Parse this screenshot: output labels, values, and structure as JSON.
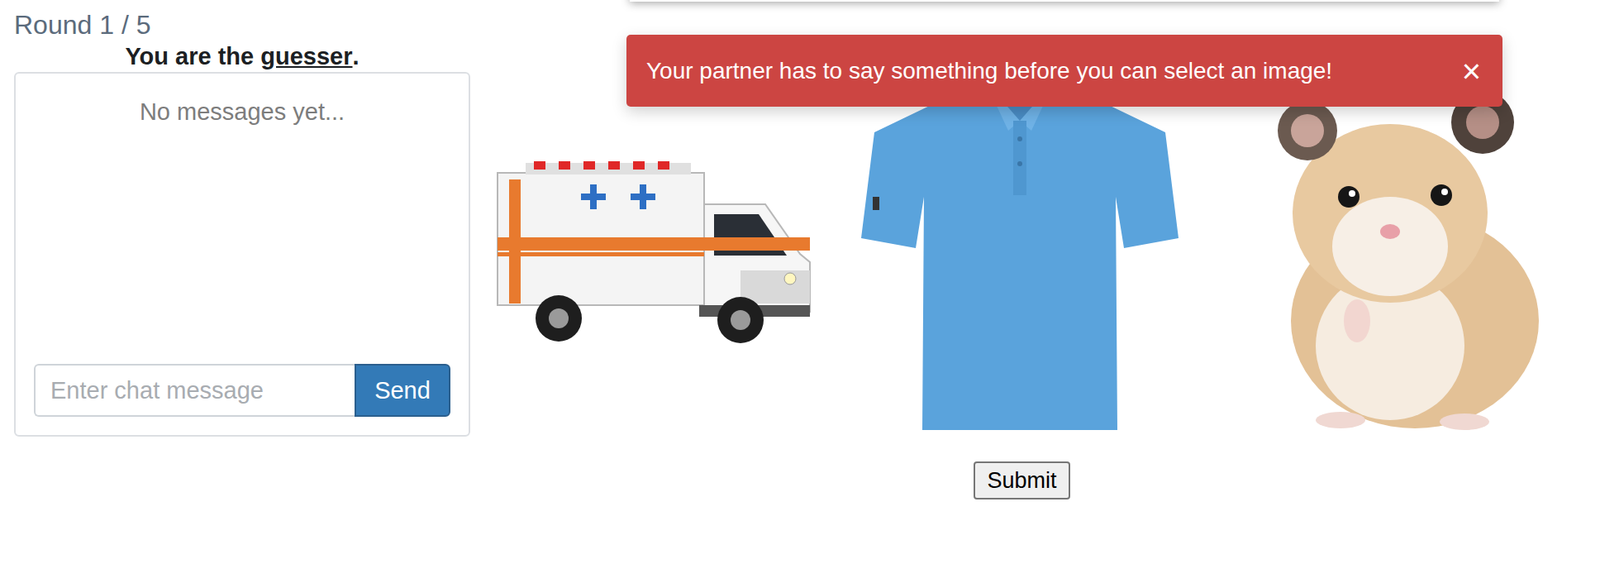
{
  "round": {
    "label": "Round 1 / 5"
  },
  "role": {
    "prefix": "You are the ",
    "role": "guesser",
    "suffix": "."
  },
  "chat": {
    "empty_text": "No messages yet...",
    "messages": [],
    "input": {
      "placeholder": "Enter chat message",
      "value": ""
    },
    "send_button": "Send"
  },
  "alert": {
    "text": "Your partner has to say something before you can select an image!",
    "close": "×"
  },
  "images": [
    {
      "kind": "ambulance",
      "selected": false
    },
    {
      "kind": "shirt",
      "selected": false
    },
    {
      "kind": "hamster",
      "selected": false
    }
  ],
  "submit_button": "Submit"
}
